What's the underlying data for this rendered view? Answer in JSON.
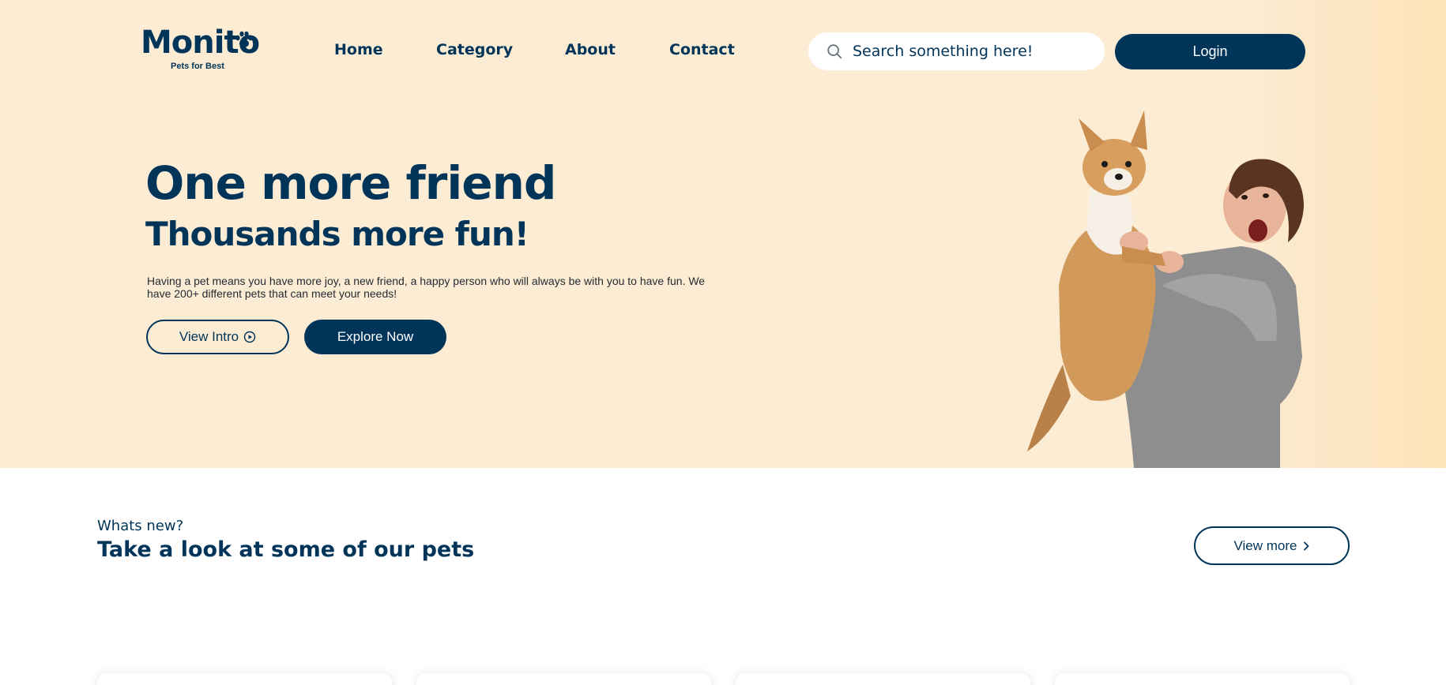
{
  "brand": {
    "name": "Monito",
    "tagline": "Pets for Best"
  },
  "nav": {
    "home": "Home",
    "category": "Category",
    "about": "About",
    "contact": "Contact"
  },
  "search": {
    "placeholder": "Search something here!"
  },
  "header": {
    "login_label": "Login"
  },
  "hero": {
    "title": "One more friend",
    "subtitle": "Thousands more fun!",
    "description": "Having a pet means you have more joy, a new friend, a happy person who will always be with you to have fun. We have 200+ different pets that can meet your needs!",
    "view_intro_label": "View Intro",
    "explore_label": "Explore Now"
  },
  "section": {
    "eyebrow": "Whats new?",
    "title": "Take a look at some of our pets",
    "view_more_label": "View more"
  },
  "colors": {
    "primary": "#003459",
    "hero_bg": "#fcecd4"
  },
  "icons": [
    "paw-icon",
    "search-icon",
    "play-circle-icon",
    "chevron-right-icon"
  ]
}
